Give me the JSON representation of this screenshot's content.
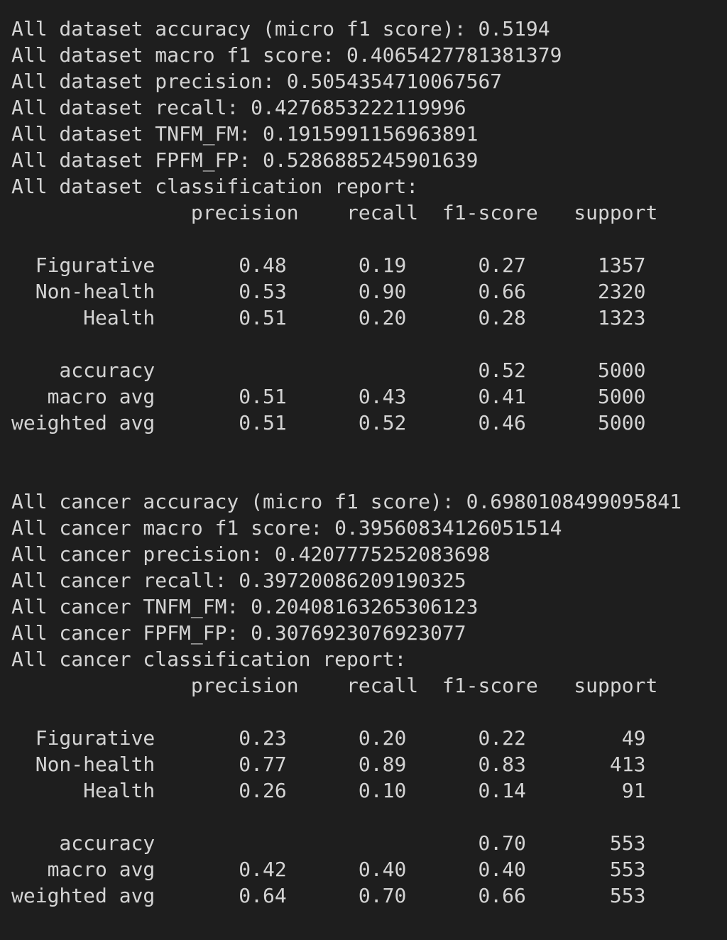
{
  "terminal": {
    "lines": [
      "All dataset accuracy (micro f1 score): 0.5194",
      "All dataset macro f1 score: 0.4065427781381379",
      "All dataset precision: 0.5054354710067567",
      "All dataset recall: 0.4276853222119996",
      "All dataset TNFM_FM: 0.1915991156963891",
      "All dataset FPFM_FP: 0.5286885245901639",
      "All dataset classification report:",
      "               precision    recall  f1-score   support",
      "",
      "  Figurative       0.48      0.19      0.27      1357",
      "  Non-health       0.53      0.90      0.66      2320",
      "      Health       0.51      0.20      0.28      1323",
      "",
      "    accuracy                           0.52      5000",
      "   macro avg       0.51      0.43      0.41      5000",
      "weighted avg       0.51      0.52      0.46      5000",
      "",
      "",
      "All cancer accuracy (micro f1 score): 0.6980108499095841",
      "All cancer macro f1 score: 0.39560834126051514",
      "All cancer precision: 0.4207775252083698",
      "All cancer recall: 0.39720086209190325",
      "All cancer TNFM_FM: 0.20408163265306123",
      "All cancer FPFM_FP: 0.3076923076923077",
      "All cancer classification report:",
      "               precision    recall  f1-score   support",
      "",
      "  Figurative       0.23      0.20      0.22        49",
      "  Non-health       0.77      0.89      0.83       413",
      "      Health       0.26      0.10      0.14        91",
      "",
      "    accuracy                           0.70       553",
      "   macro avg       0.42      0.40      0.40       553",
      "weighted avg       0.64      0.70      0.66       553"
    ]
  },
  "colors": {
    "background": "#1e1e1e",
    "text": "#d4d4d4"
  }
}
